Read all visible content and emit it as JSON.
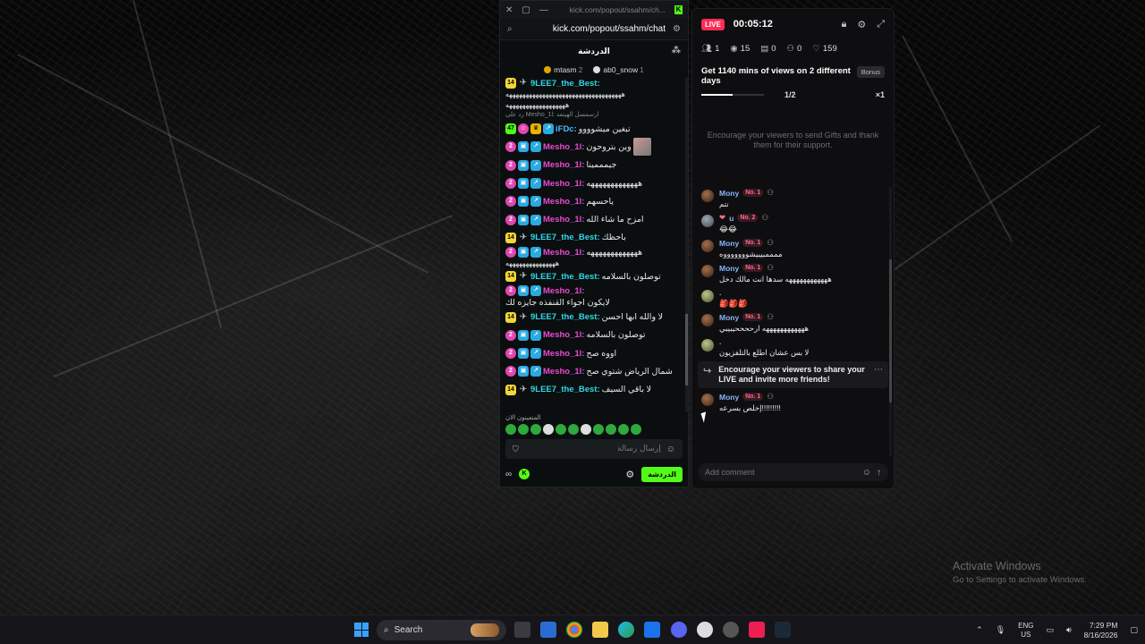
{
  "kick": {
    "title_url": "kick.com/popout/ssahm/ch...",
    "address": "kick.com/popout/ssahm/chat",
    "header_title": "الدردشة",
    "pinned": [
      {
        "name": "mtasm",
        "count": "2"
      },
      {
        "name": "ab0_snow",
        "count": "1"
      }
    ],
    "messages": [
      {
        "user": "9LEE7_the_Best:",
        "text": "",
        "wrap": "هههههههههههههههههههههههههههههههههههه"
      },
      {
        "user": "",
        "text": "",
        "wrap": "ههههههههههههههههههه"
      },
      {
        "reply": "رد على Mesho_1l: ارسمسل الهيتفد"
      },
      {
        "user": "iFDc:",
        "text": "تبغين ميشوووو"
      },
      {
        "user": "Mesho_1l:",
        "text": "وين بتروحون"
      },
      {
        "user": "Mesho_1l:",
        "text": "جيمممينا"
      },
      {
        "user": "Mesho_1l:",
        "text": "هههههههههههههه"
      },
      {
        "user": "Mesho_1l:",
        "text": "ياحسهم"
      },
      {
        "user": "Mesho_1l:",
        "text": "امزح ما شاء الله"
      },
      {
        "user": "9LEE7_the_Best:",
        "text": "باحظك"
      },
      {
        "user": "Mesho_1l:",
        "text": "هههههههههههههه",
        "wrap": "هههههههههههههههه"
      },
      {
        "user": "9LEE7_the_Best:",
        "text": "توصلون بالسلامه"
      },
      {
        "user": "Mesho_1l:",
        "text": "لايكون اجواء القنفذه جايزه لك"
      },
      {
        "user": "9LEE7_the_Best:",
        "text": "لا والله ابها احسن"
      },
      {
        "user": "Mesho_1l:",
        "text": "توصلون بالسلامه"
      },
      {
        "user": "Mesho_1l:",
        "text": "اووه صح"
      },
      {
        "user": "Mesho_1l:",
        "text": "شمال الرياض شتوي صح"
      },
      {
        "user": "9LEE7_the_Best:",
        "text": "لا باقي السيف"
      }
    ],
    "emote_label": "المتعينون الان",
    "input_placeholder": "إرسال رسالة",
    "chat_button": "الدردشة"
  },
  "live": {
    "badge": "LIVE",
    "timer": "00:05:12",
    "stats": {
      "viewers_icon": "1",
      "views": "15",
      "gifts": "0",
      "new_followers": "0",
      "likes": "159"
    },
    "goal": {
      "title": "Get 1140 mins of views on 2 different days",
      "bonus": "Bonus",
      "progress": "1/2",
      "multiplier": "×1",
      "fraction": 0.5
    },
    "gift_prompt": "Encourage your viewers to send Gifts and thank them for their support.",
    "comments": [
      {
        "name": "Mony",
        "rank": "No. 1",
        "text": "نتم"
      },
      {
        "name": "u",
        "rank": "No. 2",
        "text": "😂😂"
      },
      {
        "name": "Mony",
        "rank": "No. 1",
        "text": "ممممبيبيشوووووووه"
      },
      {
        "name": "Mony",
        "rank": "No. 1",
        "text": "ههههههههههههه سدها انت مالك دخل"
      },
      {
        "name": ".",
        "rank": "",
        "text": "🎒🎒🎒"
      },
      {
        "name": "Mony",
        "rank": "No. 1",
        "text": "ههههههههههههه ارححححيبيبي"
      },
      {
        "name": ".",
        "rank": "",
        "text": "لا بس عشان اطلع بالتلفزيون"
      }
    ],
    "share_prompt": "Encourage your viewers to share your LIVE and invite more friends!",
    "last_comment": {
      "name": "Mony",
      "rank": "No. 1",
      "text": "!!!!!!!!!إخلص بسرعه"
    },
    "add_comment_placeholder": "Add comment"
  },
  "windows": {
    "activate_title": "Activate Windows",
    "activate_sub": "Go to Settings to activate Windows.",
    "search_label": "Search",
    "lang_top": "ENG",
    "lang_bottom": "US",
    "time": "7:29 PM",
    "date": "8/16/2026"
  }
}
